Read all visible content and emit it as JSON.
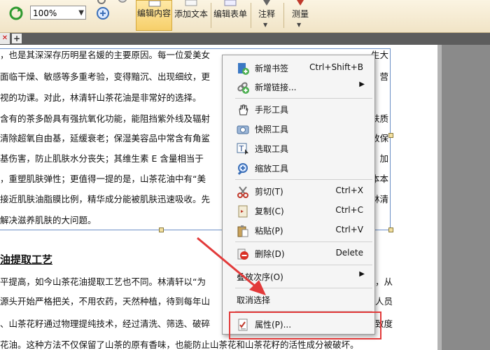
{
  "toolbar": {
    "zoom_value": "100%",
    "buttons": [
      {
        "label": "编辑内容",
        "active": true
      },
      {
        "label": "添加文本"
      },
      {
        "label": "编辑表单"
      },
      {
        "label": "注释"
      },
      {
        "label": "测量"
      }
    ]
  },
  "document": {
    "paragraphs": [
      "，也是其深深存历明星名媛的主要原因。每一位爱美女",
      "面临干燥、敏感等多重考验，变得黯沉、出现细纹，更",
      "视的功课。对此，林清轩山茶花油是非常好的选择。",
      "含有的茶多酚具有强抗氧化功能，能阻挡紫外线及辐射",
      "清除超氧自由基，延缓衰老；保湿美容品中常含有角鲨",
      "基伤害，防止肌肤水分丧失；其维生素 E 含量相当于",
      "，重塑肌肤弹性；更值得一提的是，山茶花油中有“美",
      "接近肌肤油脂膜比例，精华成分能被肌肤迅速吸收。先",
      "解决滋养肌肤的大问题。"
    ],
    "right_fragments": [
      "生大",
      "，营",
      "肤质",
      "放保",
      "，加",
      "本本",
      "林清"
    ],
    "section_title": "油提取工艺",
    "lower_paragraphs": [
      "平提高，如今山茶花油提取工艺也不同。林清轩以“为",
      "源头开始严格把关，不用农药，天然种植，待到每年山",
      "、山茶花籽通过物理提纯技术，经过清洗、筛选、破碎",
      "花油。这种方法不仅保留了山茶的原有香味，也能防止山茶花和山茶花籽的活性成分被破坏。"
    ],
    "lower_right_fragments": [
      "，从",
      "人员",
      "致度"
    ]
  },
  "context_menu": {
    "items": [
      {
        "label": "新增书签",
        "shortcut": "Ctrl+Shift+B",
        "icon": "bookmark-add-icon"
      },
      {
        "label": "新增链接...",
        "submenu": true,
        "icon": "link-add-icon"
      },
      {
        "label": "手形工具",
        "icon": "hand-tool-icon"
      },
      {
        "label": "快照工具",
        "icon": "camera-icon"
      },
      {
        "label": "选取工具",
        "icon": "text-select-icon"
      },
      {
        "label": "缩放工具",
        "icon": "zoom-icon"
      },
      {
        "label": "剪切(T)",
        "shortcut": "Ctrl+X",
        "icon": "scissors-icon"
      },
      {
        "label": "复制(C)",
        "shortcut": "Ctrl+C",
        "icon": "copy-icon"
      },
      {
        "label": "粘贴(P)",
        "shortcut": "Ctrl+V",
        "icon": "paste-icon"
      },
      {
        "label": "删除(D)",
        "shortcut": "Delete",
        "icon": "delete-icon"
      },
      {
        "label": "叠放次序(O)",
        "submenu": true
      },
      {
        "label": "取消选择"
      },
      {
        "label": "属性(P)...",
        "icon": "properties-icon"
      }
    ]
  },
  "colors": {
    "highlight": "#e23a3a",
    "selection": "#6b8fc6"
  }
}
